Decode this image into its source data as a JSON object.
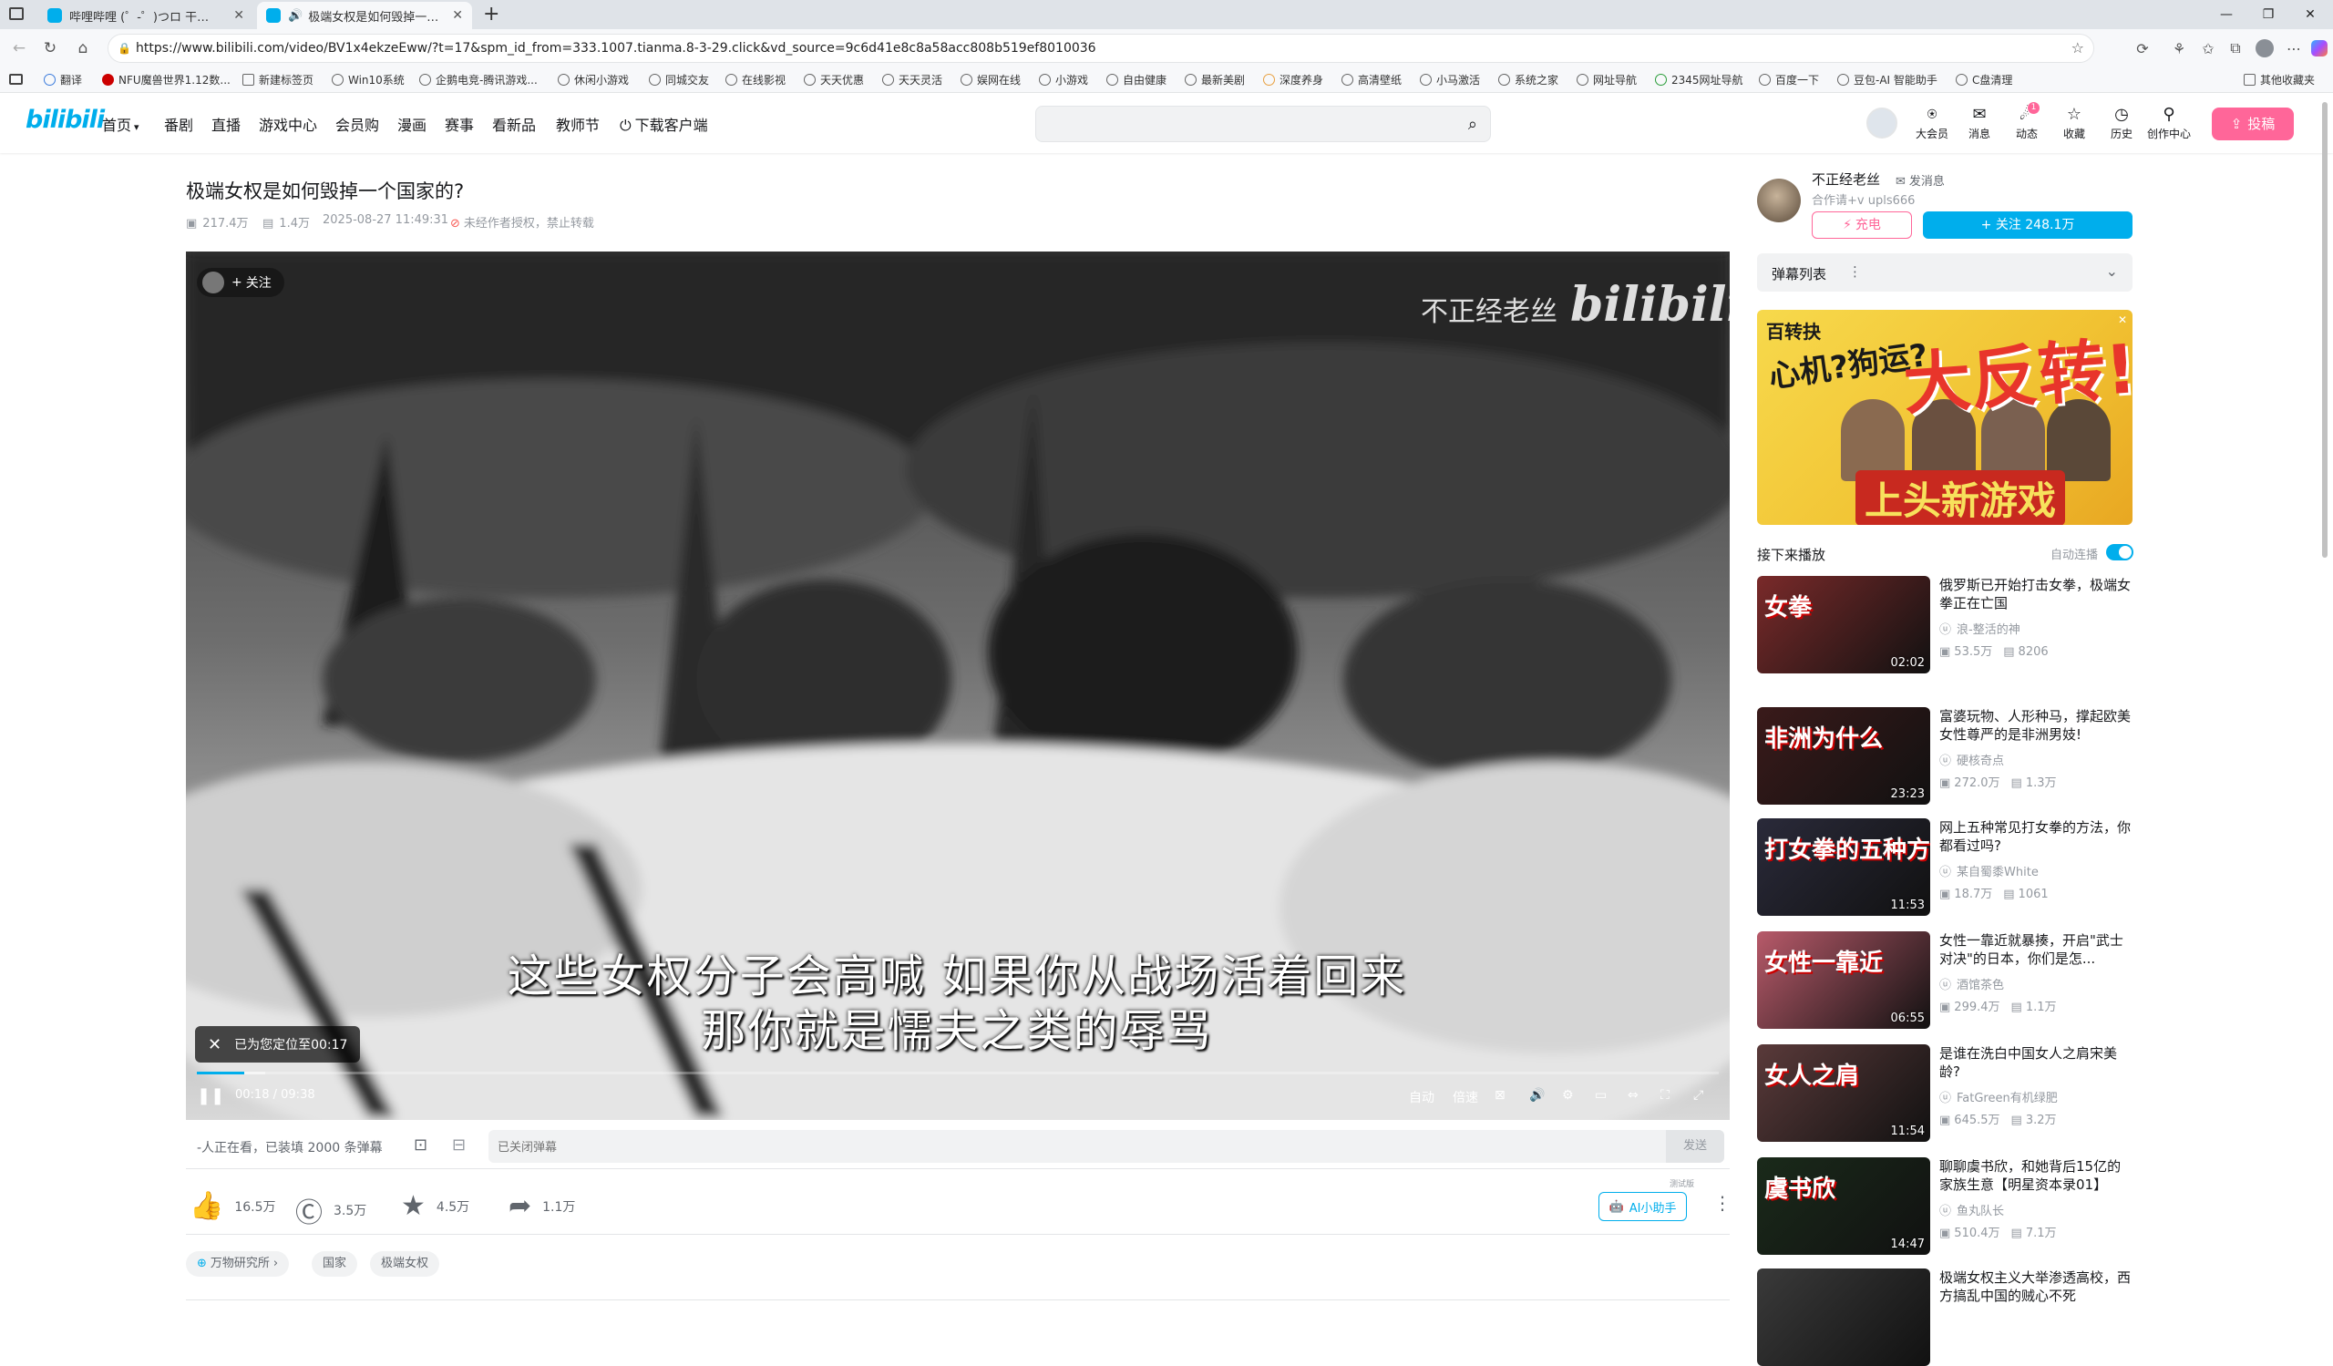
{
  "browser": {
    "tabs": [
      {
        "title": "哔哩哔哩 (゜-゜)つロ 干杯~-bilibili"
      },
      {
        "title": "极端女权是如何毁掉一个国家的?"
      }
    ],
    "new_tab": "+",
    "url": "https://www.bilibili.com/video/BV1x4ekzeEww/?t=17&spm_id_from=333.1007.tianma.8-3-29.click&vd_source=9c6d41e8c8a58acc808b519ef8010036",
    "bookmarks": [
      "翻译",
      "NFU魔兽世界1.12数...",
      "新建标签页",
      "Win10系统",
      "企鹅电竞-腾讯游戏...",
      "休闲小游戏",
      "同城交友",
      "在线影视",
      "天天优惠",
      "天天灵活",
      "娱网在线",
      "小游戏",
      "自由健康",
      "最新美剧",
      "深度养身",
      "高清壁纸",
      "小马激活",
      "系统之家",
      "网址导航",
      "2345网址导航",
      "百度一下",
      "豆包-AI 智能助手",
      "C盘清理"
    ],
    "other_bookmarks": "其他收藏夹"
  },
  "header": {
    "logo": "bilibili",
    "nav": [
      "首页",
      "番剧",
      "直播",
      "游戏中心",
      "会员购",
      "漫画",
      "赛事",
      "看新品",
      "教师节",
      "下载客户端"
    ],
    "search_placeholder": "",
    "icons": [
      {
        "label": "大会员",
        "icon": "vip-icon"
      },
      {
        "label": "消息",
        "icon": "message-icon"
      },
      {
        "label": "动态",
        "icon": "dynamic-icon",
        "badge": "1"
      },
      {
        "label": "收藏",
        "icon": "star-icon"
      },
      {
        "label": "历史",
        "icon": "history-icon"
      },
      {
        "label": "创作中心",
        "icon": "creator-icon"
      }
    ],
    "upload": "投稿"
  },
  "video": {
    "title": "极端女权是如何毁掉一个国家的?",
    "views": "217.4万",
    "danmaku": "1.4万",
    "date": "2025-08-27 11:49:31",
    "copyright": "未经作者授权，禁止转载",
    "follow_chip": "关注",
    "watermark_user": "不正经老丝",
    "watermark_brand": "bilibili",
    "subtitle_line1": "这些女权分子会高喊 如果你从战场活着回来",
    "subtitle_line2": "那你就是懦夫之类的辱骂",
    "toast": "已为您定位至00:17",
    "current_time": "00:18",
    "time_sep": "/",
    "duration": "09:38",
    "progress": 0.031,
    "buffered": 0.045,
    "controls": {
      "quality": "自动",
      "speed": "倍速"
    }
  },
  "danmaku_bar": {
    "watching": "-人正在看，已装填 2000 条弹幕",
    "placeholder": "已关闭弹幕",
    "send": "发送"
  },
  "actions": {
    "like": "16.5万",
    "coin": "3.5万",
    "favorite": "4.5万",
    "share": "1.1万",
    "ai": "AI小助手",
    "ai_tag": "测试版"
  },
  "tags": [
    "万物研究所",
    "国家",
    "极端女权"
  ],
  "uploader": {
    "name": "不正经老丝",
    "message": "发消息",
    "desc": "合作请+v upls666",
    "charge": "充电",
    "follow": "+ 关注 248.1万"
  },
  "danmaku_list": {
    "title": "弹幕列表",
    "more": "⋮"
  },
  "ad": {
    "line1": "百转抉",
    "line2": "心机?狗运?",
    "line3": "大反转!",
    "line4": "上头新游戏"
  },
  "next": {
    "title": "接下来播放",
    "autoplay": "自动连播"
  },
  "recommendations": [
    {
      "title": "俄罗斯已开始打击女拳，极端女拳正在亡国",
      "author": "浪-整活的神",
      "views": "53.5万",
      "danmaku": "8206",
      "duration": "02:02",
      "thumb_text": "女拳",
      "thumb_color": "#7a2a2a"
    },
    {
      "title": "富婆玩物、人形种马，撑起欧美女性尊严的是非洲男妓!",
      "author": "硬核奇点",
      "views": "272.0万",
      "danmaku": "1.3万",
      "duration": "23:23",
      "thumb_text": "非洲为什么",
      "thumb_color": "#3a1a1a"
    },
    {
      "title": "网上五种常见打女拳的方法，你都看过吗?",
      "author": "某自蜀黍White",
      "views": "18.7万",
      "danmaku": "1061",
      "duration": "11:53",
      "thumb_text": "打女拳的五种方法",
      "thumb_color": "#2a2a3a"
    },
    {
      "title": "女性一靠近就暴揍，开启\"武士对决\"的日本，你们是怎...",
      "author": "酒馆茶色",
      "views": "299.4万",
      "danmaku": "1.1万",
      "duration": "06:55",
      "thumb_text": "女性一靠近",
      "thumb_color": "#b85a6a"
    },
    {
      "title": "是谁在洗白中国女人之肩宋美龄?",
      "author": "FatGreen有机绿肥",
      "views": "645.5万",
      "danmaku": "3.2万",
      "duration": "11:54",
      "thumb_text": "女人之肩",
      "thumb_color": "#5a3a3a"
    },
    {
      "title": "聊聊虞书欣，和她背后15亿的家族生意【明星资本录01】",
      "author": "鱼丸队长",
      "views": "510.4万",
      "danmaku": "7.1万",
      "duration": "14:47",
      "thumb_text": "虞书欣",
      "thumb_color": "#1a2a1a"
    },
    {
      "title": "极端女权主义大举渗透高校，西方搞乱中国的贼心不死",
      "author": "",
      "views": "",
      "danmaku": "",
      "duration": "",
      "thumb_text": "",
      "thumb_color": "#3a3a3a"
    }
  ]
}
